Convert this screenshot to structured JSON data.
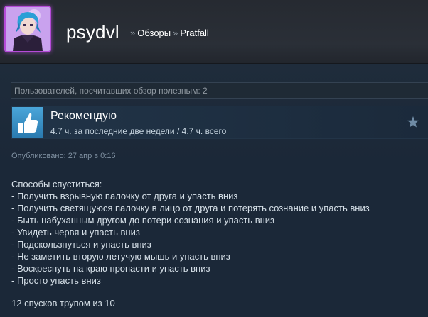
{
  "profile": {
    "name": "psydvl"
  },
  "breadcrumb": {
    "separator": "»",
    "items": [
      "Обзоры",
      "Pratfall"
    ]
  },
  "helpful": {
    "text": "Пользователей, посчитавших обзор полезным: 2"
  },
  "recommendation": {
    "title": "Рекомендую",
    "hours": "4.7 ч. за последние две недели / 4.7 ч. всего"
  },
  "posted": "Опубликовано: 27 апр в 0:16",
  "review": {
    "lines": [
      "Способы спуститься:",
      "- Получить взрывную палочку от друга и упасть вниз",
      "- Получить светящуюся палочку в лицо от друга и потерять сознание и упасть вниз",
      "- Быть набуханным другом до потери сознания и упасть вниз",
      "- Увидеть червя и упасть вниз",
      "- Подскользнуться и упасть вниз",
      "- Не заметить вторую летучую мышь и упасть вниз",
      "- Воскреснуть на краю пропасти и упасть вниз",
      "- Просто упасть вниз"
    ],
    "footer": "12 спусков трупом из 10"
  },
  "icons": {
    "avatar": "anime-avatar",
    "thumb": "thumbs-up-icon",
    "star": "star-icon"
  },
  "colors": {
    "background": "#1b2838",
    "avatar_border": "#b54bd8",
    "thumb_bg": "#3a8fc8",
    "muted_text": "#8f98a0"
  }
}
